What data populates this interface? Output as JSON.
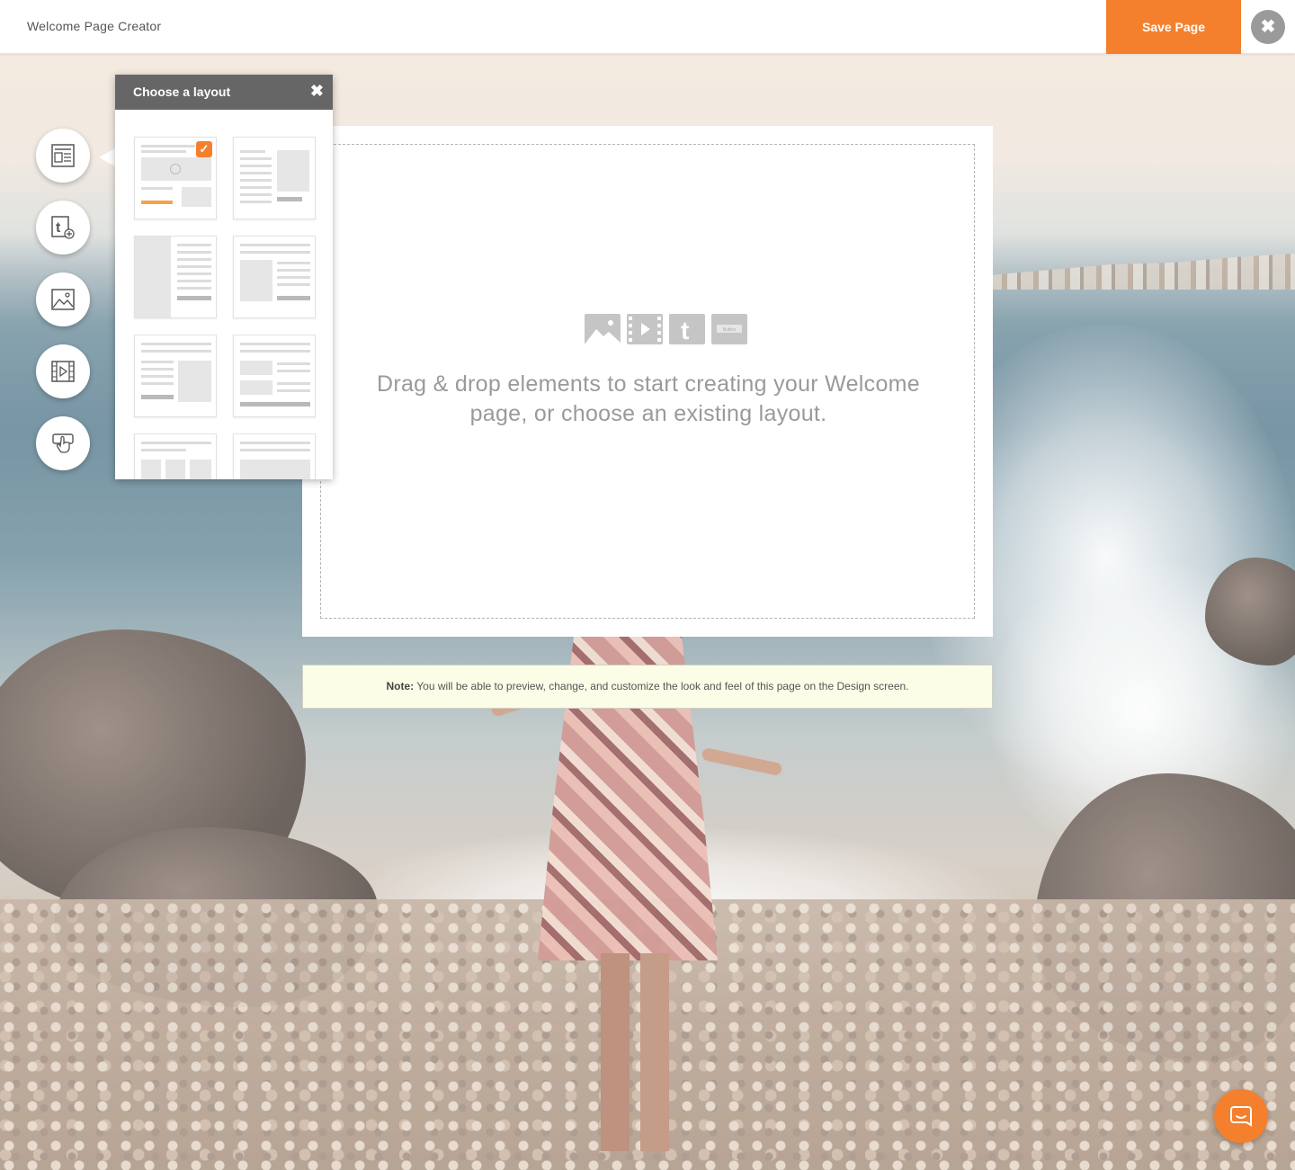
{
  "header": {
    "title": "Welcome Page Creator",
    "save_label": "Save Page",
    "close_glyph": "✖"
  },
  "toolbar": {
    "tools": [
      {
        "name": "layout-tool",
        "icon": "layout-icon"
      },
      {
        "name": "text-tool",
        "icon": "text-add-icon"
      },
      {
        "name": "image-tool",
        "icon": "image-icon"
      },
      {
        "name": "video-tool",
        "icon": "video-icon"
      },
      {
        "name": "button-tool",
        "icon": "button-hand-icon"
      }
    ]
  },
  "layout_panel": {
    "title": "Choose a layout",
    "close_glyph": "✖",
    "selected_index": 0,
    "check_glyph": "✓"
  },
  "canvas": {
    "drop_text": "Drag & drop elements to start creating your Welcome page, or choose an existing layout.",
    "element_icons": [
      "image-icon",
      "video-icon",
      "text-icon",
      "button-icon"
    ],
    "button_icon_label": "Button"
  },
  "note": {
    "label": "Note:",
    "text": " You will be able to preview, change, and customize the look and feel of this page on the Design screen."
  },
  "colors": {
    "accent": "#f4802e",
    "panel_header": "#666666",
    "note_bg": "#fbfde6"
  },
  "chat": {
    "icon": "chat-bubble-icon"
  }
}
